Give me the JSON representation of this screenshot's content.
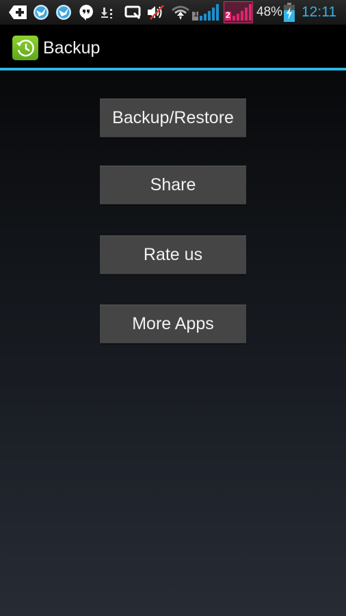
{
  "status_bar": {
    "notification_icons": [
      "add-notification-icon",
      "bird-app-icon",
      "bird-app-icon-2",
      "hangouts-icon",
      "download-icon",
      "screenshot-icon",
      "volume-muted-icon"
    ],
    "right_icons": [
      "wifi-icon",
      "signal-sim1-icon",
      "signal-sim2-icon",
      "battery-charging-icon"
    ],
    "sim1_label": "1",
    "sim2_label": "2",
    "battery_percent": "48%",
    "time": "12:11",
    "colors": {
      "sim1": "#1e90d0",
      "sim2": "#e0246e",
      "time": "#33b5e5"
    }
  },
  "action_bar": {
    "title": "Backup",
    "icon": "backup-clock-icon",
    "accent_color": "#33b5e5"
  },
  "main": {
    "buttons": [
      {
        "label": "Backup/Restore"
      },
      {
        "label": "Share"
      },
      {
        "label": "Rate us"
      },
      {
        "label": "More Apps"
      }
    ]
  }
}
